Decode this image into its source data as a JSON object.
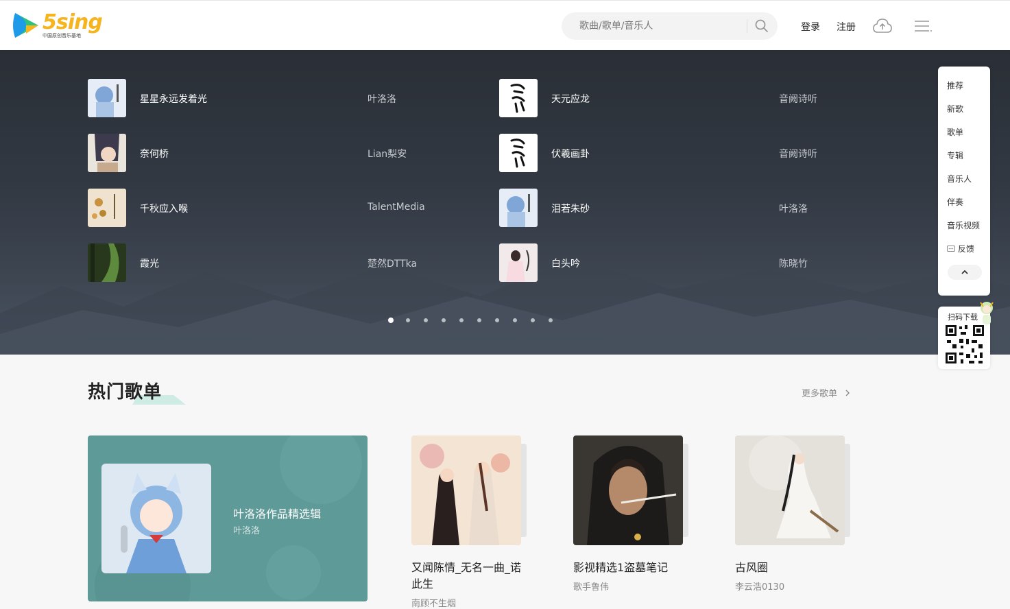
{
  "header": {
    "logo_text": "5sing",
    "logo_subtitle": "中国原创音乐基地",
    "search_placeholder": "歌曲/歌单/音乐人",
    "login": "登录",
    "register": "注册"
  },
  "songs": [
    {
      "title": "星星永远发着光",
      "artist": "叶洛洛"
    },
    {
      "title": "天元应龙",
      "artist": "音阙诗听"
    },
    {
      "title": "奈何桥",
      "artist": "Lian梨安"
    },
    {
      "title": "伏羲画卦",
      "artist": "音阙诗听"
    },
    {
      "title": "千秋应入喉",
      "artist": "TalentMedia"
    },
    {
      "title": "泪若朱砂",
      "artist": "叶洛洛"
    },
    {
      "title": "霞光",
      "artist": "楚然DTTka"
    },
    {
      "title": "白头吟",
      "artist": "陈晓竹"
    }
  ],
  "carousel": {
    "total": 10,
    "active": 0
  },
  "side_panel": {
    "items": [
      "推荐",
      "新歌",
      "歌单",
      "专辑",
      "音乐人",
      "伴奏",
      "音乐视频",
      "反馈"
    ],
    "qr_label": "扫码下载"
  },
  "hot_playlists": {
    "title": "热门歌单",
    "more": "更多歌单",
    "featured": {
      "title": "叶洛洛作品精选辑",
      "author": "叶洛洛"
    },
    "items": [
      {
        "title": "又闻陈情_无名一曲_诺此生",
        "author": "南顾不生烟"
      },
      {
        "title": "影视精选1盗墓笔记",
        "author": "歌手鲁伟"
      },
      {
        "title": "古风圈",
        "author": "李云浩0130"
      }
    ]
  },
  "colors": {
    "logo_yellow": "#f6b51e",
    "logo_green": "#2ec27e",
    "logo_blue": "#1e9be8",
    "featured_bg": "#5e9a98",
    "banner_dark": "#2a2f36"
  }
}
